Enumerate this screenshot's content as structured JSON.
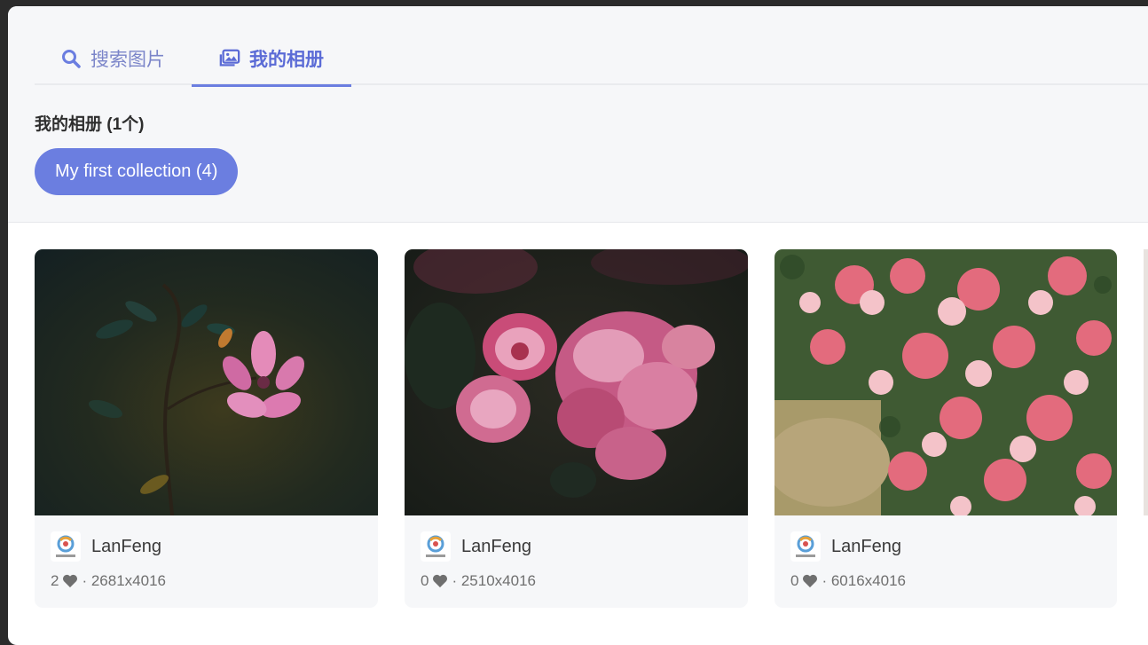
{
  "tabs": {
    "search_label": "搜索图片",
    "album_label": "我的相册"
  },
  "section": {
    "title": "我的相册 (1个)"
  },
  "collection": {
    "label": "My first collection (4)"
  },
  "photos": [
    {
      "author": "LanFeng",
      "likes": "2",
      "resolution": "· 2681x4016"
    },
    {
      "author": "LanFeng",
      "likes": "0",
      "resolution": "· 2510x4016"
    },
    {
      "author": "LanFeng",
      "likes": "0",
      "resolution": "· 6016x4016"
    }
  ],
  "colors": {
    "accent": "#6b7ee0",
    "panel": "#f6f7f9"
  }
}
